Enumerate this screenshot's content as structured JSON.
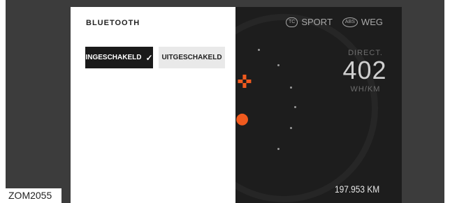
{
  "panel": {
    "title": "BLUETOOTH",
    "options": {
      "on_label": "INGESCHAKELD",
      "off_label": "UITGESCHAKELD",
      "selected": "on"
    }
  },
  "dashboard": {
    "modes": [
      {
        "badge": "TC",
        "label": "SPORT"
      },
      {
        "badge": "ABS",
        "label": "WEG"
      }
    ],
    "consumption": {
      "label": "DIRECT.",
      "value": "402",
      "unit": "WH/KM"
    },
    "odometer": "197.953 KM",
    "accent_color": "#f05a1e"
  },
  "caption": "ZOM2055",
  "icons": [
    "checkmark-icon",
    "traction-control-icon",
    "abs-icon",
    "warning-glyph-icon"
  ]
}
